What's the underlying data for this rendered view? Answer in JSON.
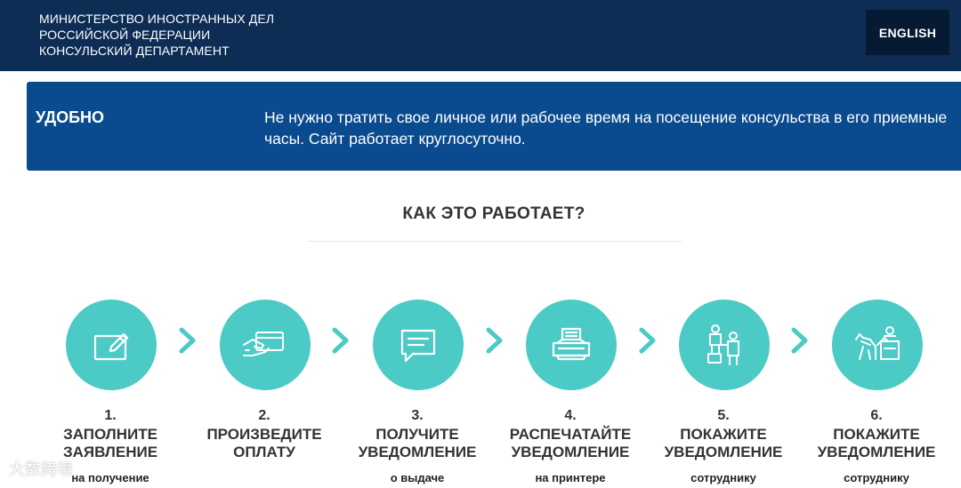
{
  "header": {
    "ministry_lines": [
      "МИНИСТЕРСТВО ИНОСТРАННЫХ ДЕЛ",
      "РОССИЙСКОЙ ФЕДЕРАЦИИ",
      "КОНСУЛЬСКИЙ ДЕПАРТАМЕНТ"
    ],
    "language_button": "ENGLISH"
  },
  "banner": {
    "title": "УДОБНО",
    "text": "Не нужно тратить свое личное или рабочее время на посещение консульства в его приемные часы. Сайт работает круглосуточно."
  },
  "how_it_works": {
    "title": "КАК ЭТО РАБОТАЕТ?",
    "steps": [
      {
        "number": "1.",
        "title_lines": [
          "ЗАПОЛНИТЕ",
          "ЗАЯВЛЕНИЕ"
        ],
        "subtitle": "на получение",
        "icon": "form-pen-icon"
      },
      {
        "number": "2.",
        "title_lines": [
          "ПРОИЗВЕДИТЕ",
          "ОПЛАТУ"
        ],
        "subtitle": "",
        "icon": "card-payment-icon"
      },
      {
        "number": "3.",
        "title_lines": [
          "ПОЛУЧИТЕ",
          "УВЕДОМЛЕНИЕ"
        ],
        "subtitle": "о выдаче",
        "icon": "message-icon"
      },
      {
        "number": "4.",
        "title_lines": [
          "РАСПЕЧАТАЙТЕ",
          "УВЕДОМЛЕНИЕ"
        ],
        "subtitle": "на принтере",
        "icon": "printer-icon"
      },
      {
        "number": "5.",
        "title_lines": [
          "ПОКАЖИТЕ",
          "УВЕДОМЛЕНИЕ"
        ],
        "subtitle": "сотруднику",
        "icon": "passenger-icon"
      },
      {
        "number": "6.",
        "title_lines": [
          "ПОКАЖИТЕ",
          "УВЕДОМЛЕНИЕ"
        ],
        "subtitle": "сотруднику",
        "icon": "border-control-icon"
      }
    ]
  },
  "watermark": "大数跨境",
  "colors": {
    "header_bg": "#0d2d55",
    "banner_bg": "#0a4a8e",
    "accent_teal": "#4ccac6"
  }
}
